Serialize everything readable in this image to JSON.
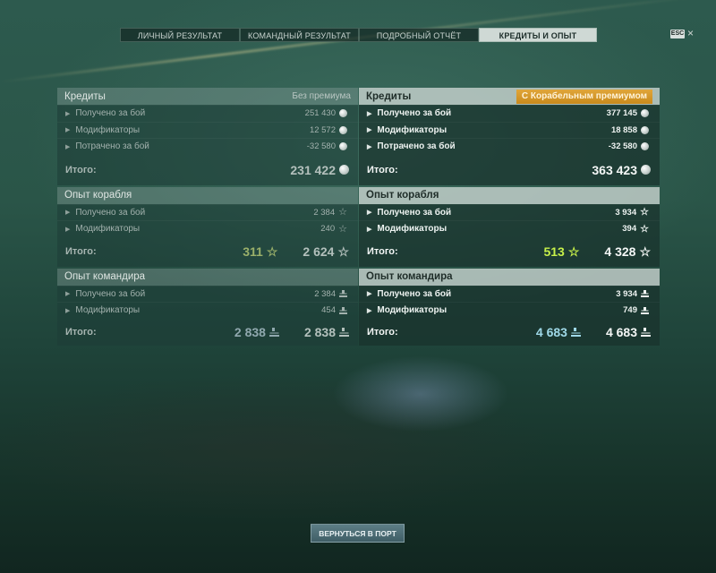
{
  "tabs": [
    {
      "label": "ЛИЧНЫЙ РЕЗУЛЬТАТ"
    },
    {
      "label": "КОМАНДНЫЙ РЕЗУЛЬТАТ"
    },
    {
      "label": "ПОДРОБНЫЙ ОТЧЁТ"
    },
    {
      "label": "КРЕДИТЫ И ОПЫТ"
    }
  ],
  "active_tab": "КРЕДИТЫ И ОПЫТ",
  "esc": {
    "label": "ESC",
    "close": "×"
  },
  "left": {
    "credits": {
      "title": "Кредиты",
      "badge": "Без премиума",
      "rows": [
        {
          "label": "Получено за бой",
          "value": "251 430"
        },
        {
          "label": "Модификаторы",
          "value": "12 572"
        },
        {
          "label": "Потрачено за бой",
          "value": "-32 580"
        }
      ],
      "total_label": "Итого:",
      "total_value": "231 422"
    },
    "ship_xp": {
      "title": "Опыт корабля",
      "rows": [
        {
          "label": "Получено за бой",
          "value": "2 384"
        },
        {
          "label": "Модификаторы",
          "value": "240"
        }
      ],
      "total_label": "Итого:",
      "free_value": "311",
      "total_value": "2 624"
    },
    "captain_xp": {
      "title": "Опыт командира",
      "rows": [
        {
          "label": "Получено за бой",
          "value": "2 384"
        },
        {
          "label": "Модификаторы",
          "value": "454"
        }
      ],
      "total_label": "Итого:",
      "extra_value": "2 838",
      "total_value": "2 838"
    }
  },
  "right": {
    "credits": {
      "title": "Кредиты",
      "badge": "С Корабельным премиумом",
      "rows": [
        {
          "label": "Получено за бой",
          "value": "377 145"
        },
        {
          "label": "Модификаторы",
          "value": "18 858"
        },
        {
          "label": "Потрачено за бой",
          "value": "-32 580"
        }
      ],
      "total_label": "Итого:",
      "total_value": "363 423"
    },
    "ship_xp": {
      "title": "Опыт корабля",
      "rows": [
        {
          "label": "Получено за бой",
          "value": "3 934"
        },
        {
          "label": "Модификаторы",
          "value": "394"
        }
      ],
      "total_label": "Итого:",
      "free_value": "513",
      "total_value": "4 328"
    },
    "captain_xp": {
      "title": "Опыт командира",
      "rows": [
        {
          "label": "Получено за бой",
          "value": "3 934"
        },
        {
          "label": "Модификаторы",
          "value": "749"
        }
      ],
      "total_label": "Итого:",
      "extra_value": "4 683",
      "total_value": "4 683"
    }
  },
  "icons": {
    "credits": "coin-icon",
    "ship_xp": "star-icon",
    "captain_xp": "captain-icon",
    "row_marker": "triangle-right-icon"
  },
  "colors": {
    "premium_badge": "#d99a2b",
    "free_xp": "#c7f04a",
    "captain_total": "#9fd9e8",
    "button": "#4a6a72"
  },
  "return_button": {
    "label": "ВЕРНУТЬСЯ В ПОРТ"
  }
}
